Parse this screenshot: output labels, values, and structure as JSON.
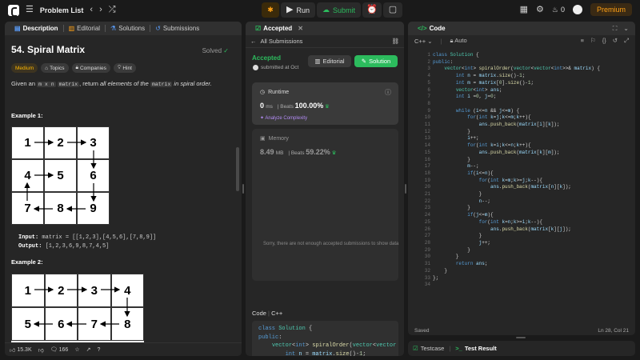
{
  "topbar": {
    "problem_list": "Problem List",
    "run": "Run",
    "submit": "Submit",
    "streak": "0",
    "premium": "Premium"
  },
  "left": {
    "tabs": [
      "Description",
      "Editorial",
      "Solutions",
      "Submissions"
    ],
    "title": "54. Spiral Matrix",
    "solved": "Solved",
    "tags": [
      "Medium",
      "Topics",
      "Companies",
      "Hint"
    ],
    "desc_parts": [
      "Given an ",
      "m x n",
      " ",
      "matrix",
      ", return ",
      "all elements of the",
      " ",
      "matrix",
      " in spiral order."
    ],
    "example1_title": "Example 1:",
    "example2_title": "Example 2:",
    "grid1": [
      "1",
      "2",
      "3",
      "4",
      "5",
      "6",
      "7",
      "8",
      "9"
    ],
    "grid2": [
      "1",
      "2",
      "3",
      "4",
      "5",
      "6",
      "7",
      "8"
    ],
    "input_label": "Input:",
    "input_value": "matrix = [[1,2,3],[4,5,6],[7,8,9]]",
    "output_label": "Output:",
    "output_value": "[1,2,3,6,9,8,7,4,5]",
    "likes": "15.3K",
    "comments": "166"
  },
  "mid": {
    "tab": "Accepted",
    "all_submissions": "All Submissions",
    "accepted": "Accepted",
    "submitted_at": "submitted at Oct",
    "editorial_btn": "Editorial",
    "solution_btn": "Solution",
    "runtime_label": "Runtime",
    "runtime_val": "0",
    "runtime_unit": "ms",
    "beats_label": "Beats",
    "runtime_beats": "100.00%",
    "analyze": "Analyze Complexity",
    "memory_label": "Memory",
    "memory_val": "8.49",
    "memory_unit": "MB",
    "memory_beats": "59.22%",
    "sorry": "Sorry, there are not enough accepted submissions to show data",
    "code_label": "Code",
    "lang": "C++"
  },
  "right": {
    "tab": "Code",
    "lang": "C++",
    "auto": "Auto",
    "saved": "Saved",
    "cursor": "Ln 28, Col 21",
    "testcase": "Testcase",
    "test_result": "Test Result"
  },
  "colors": {
    "accent_green": "#2cbb5d",
    "accent_orange": "#ffa116",
    "medium": "#ffb800"
  }
}
